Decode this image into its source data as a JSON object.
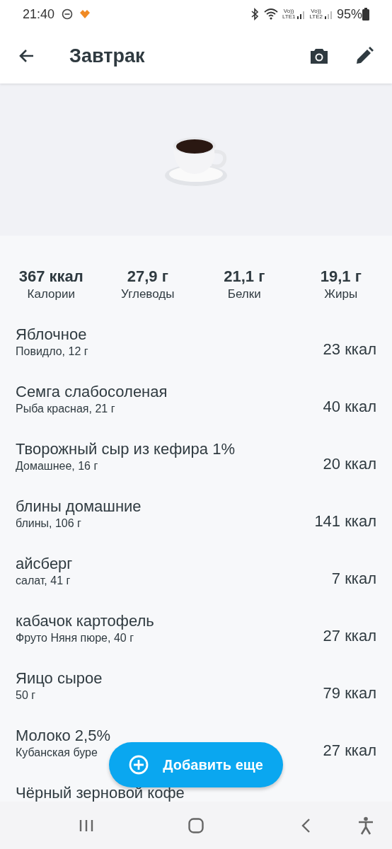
{
  "status_bar": {
    "time": "21:40",
    "battery": "95%",
    "sim1": "LTE1",
    "sim2": "LTE2",
    "volte1": "Vo))",
    "volte2": "Vo))"
  },
  "app_bar": {
    "title": "Завтрак"
  },
  "summary": [
    {
      "value": "367 ккал",
      "label": "Калории"
    },
    {
      "value": "27,9 г",
      "label": "Углеводы"
    },
    {
      "value": "21,1 г",
      "label": "Белки"
    },
    {
      "value": "19,1 г",
      "label": "Жиры"
    }
  ],
  "items": [
    {
      "name": "Яблочное",
      "detail": "Повидло, 12 г",
      "calories": "23 ккал"
    },
    {
      "name": "Семга слабосоленая",
      "detail": "Рыба красная, 21 г",
      "calories": "40 ккал"
    },
    {
      "name": "Творожный сыр из кефира 1%",
      "detail": "Домашнее, 16 г",
      "calories": "20 ккал"
    },
    {
      "name": "блины домашние",
      "detail": "блины, 106 г",
      "calories": "141 ккал"
    },
    {
      "name": "айсберг",
      "detail": "салат, 41 г",
      "calories": "7 ккал"
    },
    {
      "name": "кабачок картофель",
      "detail": "Фруто Няня пюре, 40 г",
      "calories": "27 ккал"
    },
    {
      "name": "Яицо сырое",
      "detail": "50 г",
      "calories": "79 ккал"
    },
    {
      "name": "Молоко 2,5%",
      "detail": "Кубанская буре",
      "calories": "27 ккал"
    },
    {
      "name": "Чёрный зерновой кофе"
    }
  ],
  "fab": {
    "label": "Добавить еще"
  }
}
